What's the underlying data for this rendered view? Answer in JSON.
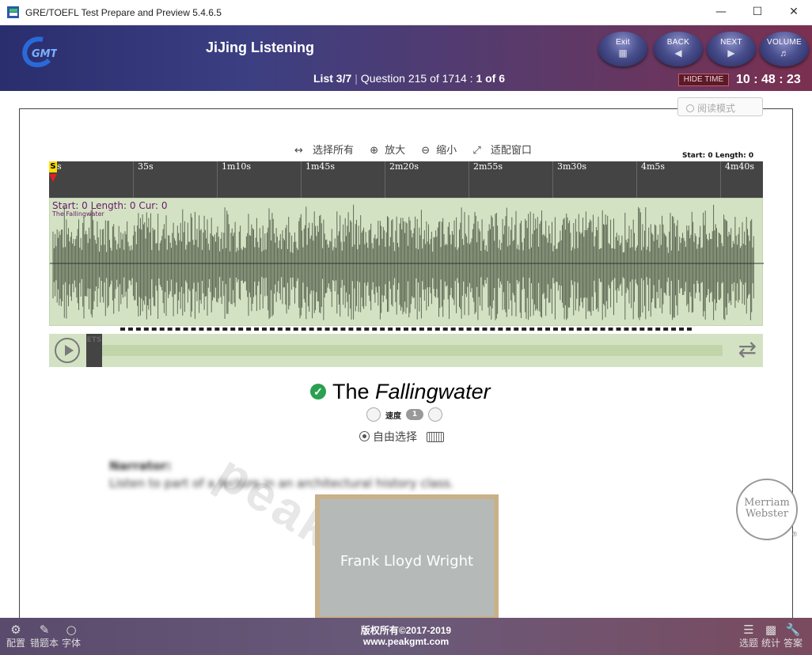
{
  "window": {
    "title": "GRE/TOEFL Test Prepare and Preview 5.4.6.5"
  },
  "header": {
    "page_title": "JiJing Listening",
    "list": "List 3/7",
    "question": "Question 215 of 1714",
    "part": "1 of 6",
    "buttons": {
      "exit": "Exit",
      "back": "BACK",
      "next": "NEXT",
      "volume": "VOLUME"
    },
    "hide_time": "HIDE TIME",
    "timer": "10 : 48 : 23"
  },
  "reading_mode": "阅读模式",
  "wave": {
    "tools": {
      "select_all": "选择所有",
      "zoom_in": "放大",
      "zoom_out": "缩小",
      "fit": "适配窗口"
    },
    "selection_info": "Start: 0 Length: 0",
    "start_mark": "S",
    "ticks": [
      "s",
      "35s",
      "1m10s",
      "1m45s",
      "2m20s",
      "2m55s",
      "3m30s",
      "4m5s",
      "4m40s"
    ],
    "info": "Start: 0 Length: 0 Cur: 0",
    "track_name": "The Fallingwater"
  },
  "player": {
    "ets": "ETS"
  },
  "question": {
    "title_prefix": "The",
    "title_italic": "Fallingwater",
    "speed_label": "速度",
    "speed_value": "1",
    "free_select": "自由选择",
    "narrator_label": "Narrator:",
    "narrator_text": "Listen to part of a lecture in an architectural history class.",
    "picture_caption": "Frank Lloyd Wright",
    "watermark": "peakGMT"
  },
  "mw_logo": {
    "line1": "Merriam",
    "line2": "Webster",
    "mark": "®"
  },
  "footer": {
    "left": [
      {
        "label": "配置",
        "icon": "gear-icon"
      },
      {
        "label": "错题本",
        "icon": "edit-icon"
      },
      {
        "label": "字体",
        "icon": "circle-icon"
      }
    ],
    "right": [
      {
        "label": "选题",
        "icon": "list-icon"
      },
      {
        "label": "统计",
        "icon": "bar-chart-icon"
      },
      {
        "label": "答案",
        "icon": "wrench-icon"
      }
    ],
    "copyright_line1": "版权所有©2017-2019",
    "copyright_line2": "www.peakgmt.com"
  }
}
